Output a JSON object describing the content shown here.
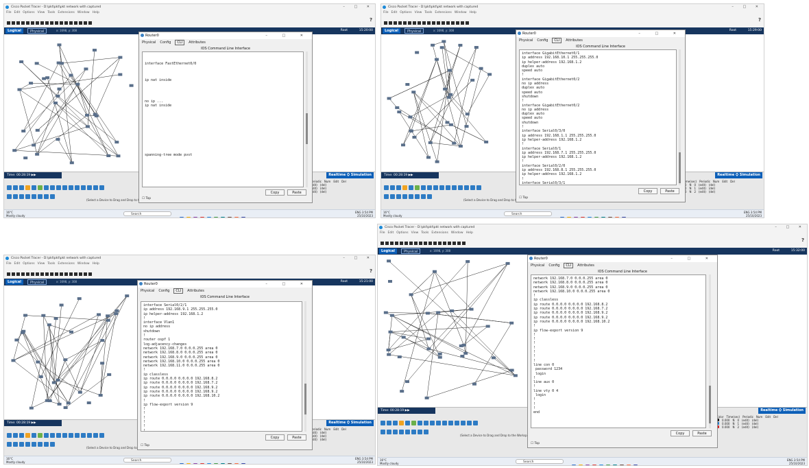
{
  "window_title": "Cisco Packet Tracer - D:\\pkt\\pkt\\pkt network with captured",
  "menu": [
    "File",
    "Edit",
    "Options",
    "View",
    "Tools",
    "Extensions",
    "Window",
    "Help"
  ],
  "help_glyph": "?",
  "nav": {
    "logical": "Logical",
    "physical": "Physical",
    "coords": "x: 1698, y: 308",
    "root": "Root"
  },
  "dialog": {
    "title": "Router0",
    "controls": "– □ ✕",
    "tabs": [
      "Physical",
      "Config",
      "CLI",
      "Attributes"
    ],
    "active_tab": "CLI",
    "cli_header": "IOS Command Line Interface",
    "copy": "Copy",
    "paste": "Paste",
    "top_label": "Top"
  },
  "sim": {
    "time": "Time: 00:28:19",
    "realtime": "Realtime",
    "simulation": "Simulation"
  },
  "palette_hint": "(Select a Device to Drag and Drop to the Workspace)",
  "pdu": {
    "headers": [
      "Color",
      "Time(sec)",
      "Periodic",
      "Num",
      "Edit",
      "Del"
    ],
    "rows": [
      {
        "color": "#1a1a1a",
        "time": "0.000",
        "periodic": "N",
        "num": "0",
        "edit": "(edit)",
        "del": "(del)"
      },
      {
        "color": "#2d7bc4",
        "time": "0.000",
        "periodic": "N",
        "num": "1",
        "edit": "(edit)",
        "del": "(del)"
      },
      {
        "color": "#d62828",
        "time": "0.000",
        "periodic": "N",
        "num": "2",
        "edit": "(edit)",
        "del": "(del)"
      }
    ]
  },
  "taskbar": {
    "weather_temp": "16°C",
    "weather_desc": "Mostly cloudy",
    "search": "Search",
    "tray_lang": "ENG",
    "time": "3:54 PM",
    "date": "25/10/2023"
  },
  "shots": [
    {
      "clock": "15:20:00",
      "cli_lines": [
        "",
        "",
        "interface FastEthernet0/0",
        "",
        "",
        "",
        "ip nat inside",
        "",
        "",
        "",
        "",
        "no ip ...",
        "ip nat inside",
        "",
        "",
        "",
        "",
        "",
        "",
        "",
        "",
        "",
        "",
        "",
        "spanning-tree mode pvst",
        ""
      ]
    },
    {
      "clock": "15:29:00",
      "cli_lines": [
        "interface GigabitEthernet0/1",
        "ip address 192.168.10.1 255.255.255.0",
        "ip helper-address 192.168.1.2",
        "duplex auto",
        "speed auto",
        "!",
        "interface GigabitEthernet0/2",
        "no ip address",
        "duplex auto",
        "speed auto",
        "shutdown",
        "!",
        "interface GigabitEthernet0/2",
        "no ip address",
        "duplex auto",
        "speed auto",
        "shutdown",
        "!",
        "interface Serial0/3/0",
        "ip address 192.168.1.1 255.255.255.0",
        "ip helper-address 192.168.1.2",
        "!",
        "interface Serial0/1",
        "ip address 192.168.7.1 255.255.255.0",
        "ip helper-address 192.168.1.2",
        "!",
        "interface Serial0/2/0",
        "ip address 192.168.8.1 255.255.255.0",
        "ip helper-address 192.168.1.2",
        "!",
        "interface Serial0/3/1",
        "ip address 192.168.9.1 255.255.255.0",
        "ip helper-address 192.168.1.2"
      ]
    },
    {
      "clock": "15:21:00",
      "cli_lines": [
        "interface Serial0/2/1",
        "ip address 192.168.9.1 255.255.255.0",
        "ip helper-address 192.168.1.2",
        "!",
        "interface Vlan1",
        "no ip address",
        "shutdown",
        "!",
        "router ospf 1",
        "log-adjacency-changes",
        "network 192.168.7.0 0.0.0.255 area 0",
        "network 192.168.8.0 0.0.0.255 area 0",
        "network 192.168.9.0 0.0.0.255 area 0",
        "network 192.168.10.0 0.0.0.255 area 0",
        "network 192.168.11.0 0.0.0.255 area 0",
        "!",
        "ip classless",
        "ip route 0.0.0.0 0.0.0.0 192.168.8.2",
        "ip route 0.0.0.0 0.0.0.0 192.168.7.2",
        "ip route 0.0.0.0 0.0.0.0 192.168.9.2",
        "ip route 0.0.0.0 0.0.0.0 192.168.9.2",
        "ip route 0.0.0.0 0.0.0.0 192.168.10.2",
        "!",
        "ip flow-export version 9",
        "!",
        "!",
        "!",
        "!",
        "!",
        "!",
        "line con 0"
      ]
    },
    {
      "clock": "15:32:00",
      "cli_lines": [
        "network 192.168.7.0 0.0.0.255 area 0",
        "network 192.168.8.0 0.0.0.255 area 0",
        "network 192.168.9.0 0.0.0.255 area 0",
        "network 192.168.10.0 0.0.0.255 area 0",
        "!",
        "ip classless",
        "ip route 0.0.0.0 0.0.0.0 192.168.8.2",
        "ip route 0.0.0.0 0.0.0.0 192.168.7.2",
        "ip route 0.0.0.0 0.0.0.0 192.168.9.2",
        "ip route 0.0.0.0 0.0.0.0 192.168.9.2",
        "ip route 0.0.0.0 0.0.0.0 192.168.10.2",
        "!",
        "ip flow-export version 9",
        "!",
        "!",
        "!",
        "!",
        "!",
        "!",
        "!",
        "line con 0",
        " password 1234",
        " login",
        "!",
        "line aux 0",
        "!",
        "line vty 0 4",
        " login",
        "!",
        "!",
        "!",
        "end"
      ]
    }
  ]
}
